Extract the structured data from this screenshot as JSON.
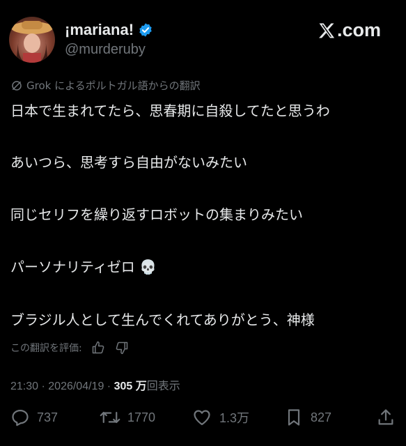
{
  "author": {
    "name": "¡mariana!",
    "handle": "@murderuby",
    "verified_color": "#1d9bf0"
  },
  "brand": {
    "text": ".com",
    "icon": "x-logo-icon"
  },
  "translation_note": "Grok によるポルトガル語からの翻訳",
  "tweet_lines": [
    "日本で生まれてたら、思春期に自殺してたと思うわ",
    "あいつら、思考すら自由がないみたい",
    "同じセリフを繰り返すロボットの集まりみたい",
    "パーソナリティゼロ 💀",
    "ブラジル人として生んでくれてありがとう、神様"
  ],
  "rate_translation_label": "この翻訳を評価:",
  "meta": {
    "time": "21:30",
    "date": "2026/04/19",
    "separator": " · ",
    "views_count": "305 万",
    "views_label": "回表示"
  },
  "actions": {
    "replies": "737",
    "retweets": "1770",
    "likes": "1.3万",
    "bookmarks": "827"
  }
}
